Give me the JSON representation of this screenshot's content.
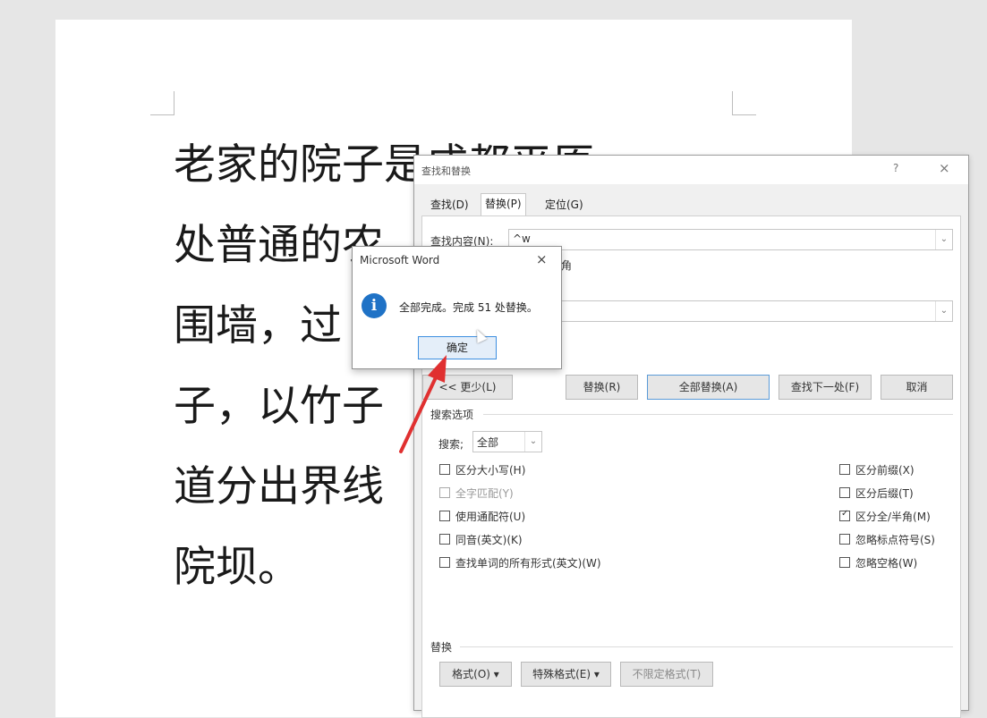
{
  "document": {
    "lines": [
      "老家的院子是成都平原",
      "处普通的农",
      "围墙，过",
      "子，以竹子",
      "道分出界线",
      "院坝。"
    ]
  },
  "find_replace": {
    "title": "查找和替换",
    "help_label": "?",
    "close_label": "×",
    "tabs": [
      "查找(D)",
      "替换(P)",
      "定位(G)"
    ],
    "find_label": "查找内容(N):",
    "find_value": "^w",
    "option_partial": "角",
    "replace_value": "",
    "buttons": {
      "less": "<< 更少(L)",
      "replace": "替换(R)",
      "replace_all": "全部替换(A)",
      "find_next": "查找下一处(F)",
      "cancel": "取消"
    },
    "search_options_title": "搜索选项",
    "search_label": "搜索;",
    "search_value": "全部",
    "left_options": [
      {
        "label": "区分大小写(H)",
        "checked": false,
        "disabled": false
      },
      {
        "label": "全字匹配(Y)",
        "checked": false,
        "disabled": true
      },
      {
        "label": "使用通配符(U)",
        "checked": false,
        "disabled": false
      },
      {
        "label": "同音(英文)(K)",
        "checked": false,
        "disabled": false
      },
      {
        "label": "查找单词的所有形式(英文)(W)",
        "checked": false,
        "disabled": false
      }
    ],
    "right_options": [
      {
        "label": "区分前缀(X)",
        "checked": false
      },
      {
        "label": "区分后缀(T)",
        "checked": false
      },
      {
        "label": "区分全/半角(M)",
        "checked": true
      },
      {
        "label": "忽略标点符号(S)",
        "checked": false
      },
      {
        "label": "忽略空格(W)",
        "checked": false
      }
    ],
    "replace_section_title": "替换",
    "bottom_buttons": [
      "格式(O) ▾",
      "特殊格式(E) ▾",
      "不限定格式(T)"
    ]
  },
  "message_box": {
    "title": "Microsoft Word",
    "close_label": "×",
    "icon": "info-icon",
    "icon_glyph": "i",
    "message": "全部完成。完成 51 处替换。",
    "ok_label": "确定"
  },
  "colors": {
    "accent_blue": "#1f72c6",
    "annotation_arrow": "#e03030"
  }
}
